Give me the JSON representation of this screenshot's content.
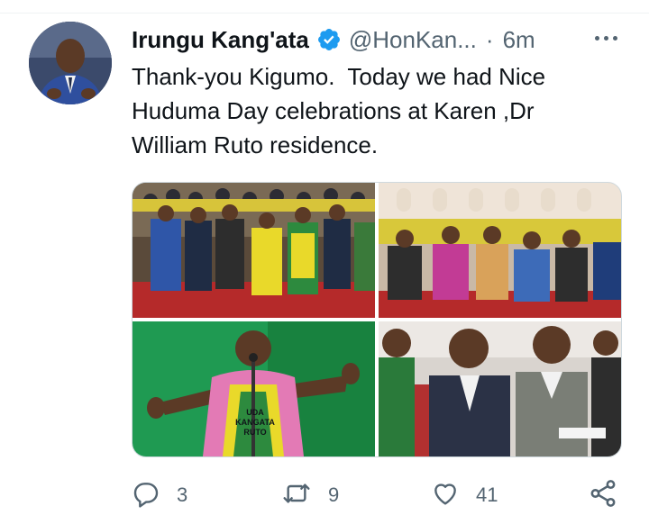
{
  "tweet": {
    "display_name": "Irungu Kang'ata",
    "handle": "@HonKan...",
    "separator": "·",
    "time": "6m",
    "text": "Thank-you Kigumo.  Today we had Nice\nHuduma Day celebrations at Karen ,Dr\nWilliam Ruto residence.",
    "verified": true,
    "apron_text": [
      "UDA",
      "KANGATA",
      "RUTO"
    ]
  },
  "icons": {
    "verified": "verified-badge-icon",
    "more": "more-options-icon",
    "reply": "reply-icon",
    "retweet": "retweet-icon",
    "like": "like-icon",
    "share": "share-icon"
  },
  "actions": {
    "reply_count": "3",
    "retweet_count": "9",
    "like_count": "41"
  },
  "colors": {
    "text": "#0f1419",
    "secondary": "#536471",
    "verified_blue": "#1d9bf0",
    "border": "#cfd9de"
  }
}
